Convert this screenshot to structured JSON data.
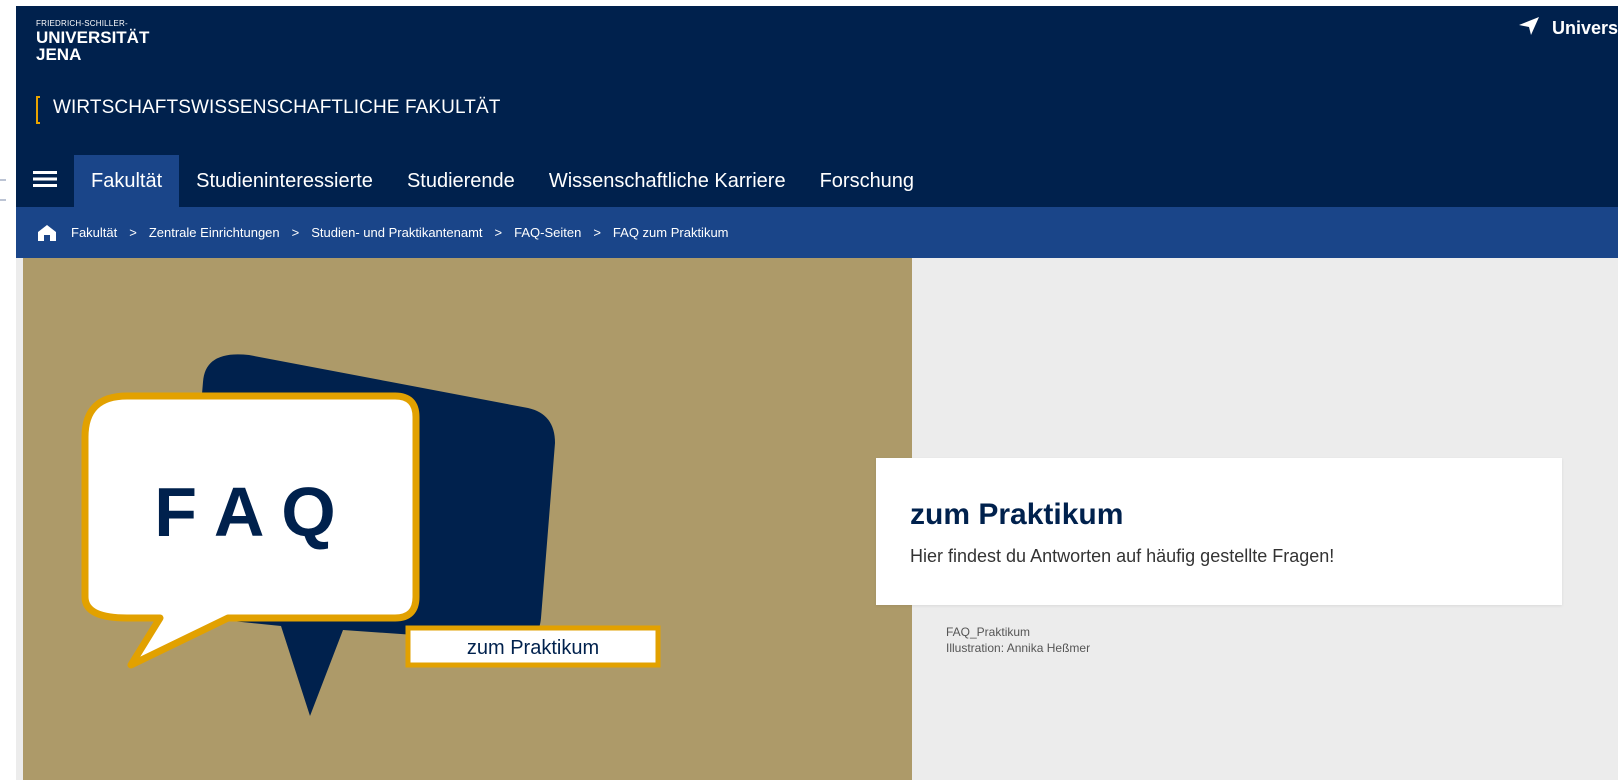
{
  "header": {
    "logo": {
      "line1": "FRIEDRICH-SCHILLER-",
      "line2": "UNIVERSITÄT",
      "line3": "JENA"
    },
    "faculty_name": "WIRTSCHAFTSWISSENSCHAFTLICHE FAKULTÄT",
    "top_link": "Univers"
  },
  "nav": {
    "items": [
      {
        "label": "Fakultät",
        "active": true
      },
      {
        "label": "Studieninteressierte"
      },
      {
        "label": "Studierende"
      },
      {
        "label": "Wissenschaftliche Karriere"
      },
      {
        "label": "Forschung"
      }
    ]
  },
  "breadcrumb": {
    "items": [
      "Fakultät",
      "Zentrale Einrichtungen",
      "Studien- und Praktikantenamt",
      "FAQ-Seiten",
      "FAQ zum Praktikum"
    ],
    "separator": ">"
  },
  "hero": {
    "image_text_main": "F A Q",
    "image_text_label": "zum Praktikum",
    "card_title": "zum Praktikum",
    "card_subtitle": "Hier findest du Antworten auf häufig gestellte Fragen!",
    "caption_line1": "FAQ_Praktikum",
    "caption_line2": "Illustration: Annika Heßmer"
  },
  "colors": {
    "header_bg": "#00214d",
    "nav_active_bg": "#1a4589",
    "breadcrumb_bg": "#1a4589",
    "accent": "#e8a300",
    "hero_bg": "#ad9a69",
    "page_bg": "#ececec"
  },
  "icons": {
    "menu": "hamburger-menu-icon",
    "home": "home-icon",
    "location": "location-arrow-icon"
  }
}
